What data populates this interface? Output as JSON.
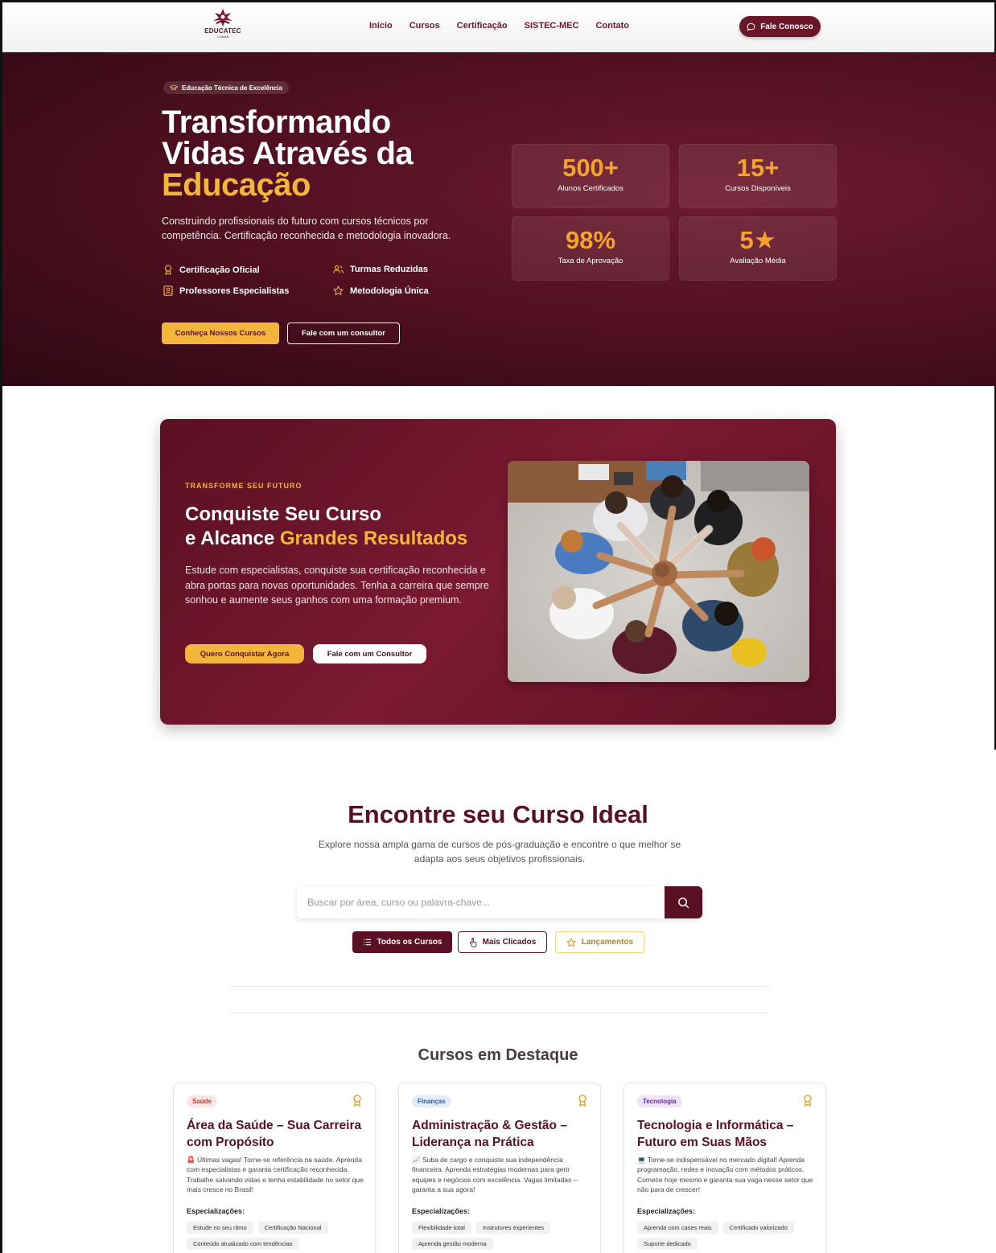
{
  "colors": {
    "brand": "#6b1528",
    "brand_dark": "#5a1024",
    "accent": "#f4b63a",
    "stat": "#f4a32f"
  },
  "header": {
    "logo_text": "EDUCATEC",
    "logo_sub": "CANAÃ",
    "nav": [
      "Início",
      "Cursos",
      "Certificação",
      "SISTEC-MEC",
      "Contato"
    ],
    "cta": "Fale Conosco",
    "cta_icon": "chat-bubble-icon"
  },
  "hero": {
    "badge": "Educação Técnica de Excelência",
    "title_line1": "Transformando",
    "title_line2": "Vidas Através da",
    "title_accent": "Educação",
    "description": "Construindo profissionais do futuro com cursos técnicos por competência. Certificação reconhecida e metodologia inovadora.",
    "features": [
      {
        "label": "Certificação Oficial",
        "icon": "award-icon"
      },
      {
        "label": "Turmas Reduzidas",
        "icon": "users-icon"
      },
      {
        "label": "Professores Especialistas",
        "icon": "teacher-icon"
      },
      {
        "label": "Metodologia Única",
        "icon": "star-icon"
      }
    ],
    "primary_button": "Conheça Nossos Cursos",
    "secondary_button": "Fale com um consultor",
    "stats": [
      {
        "value": "500+",
        "label": "Alunos Certificados"
      },
      {
        "value": "15+",
        "label": "Cursos Disponíveis"
      },
      {
        "value": "98%",
        "label": "Taxa de Aprovação"
      },
      {
        "value": "5★",
        "label": "Avaliação Média"
      }
    ]
  },
  "promo": {
    "eyebrow": "TRANSFORME SEU FUTURO",
    "title_line1": "Conquiste Seu Curso",
    "title_line2_plain": "e Alcance ",
    "title_line2_accent": "Grandes Resultados",
    "description": "Estude com especialistas, conquiste sua certificação reconhecida e abra portas para novas oportunidades. Tenha a carreira que sempre sonhou e aumente seus ganhos com uma formação premium.",
    "primary_button": "Quero Conquistar Agora",
    "secondary_button": "Fale com um Consultor"
  },
  "search": {
    "title": "Encontre seu Curso Ideal",
    "description": "Explore nossa ampla gama de cursos de pós-graduação e encontre o que melhor se adapta aos seus objetivos profissionais.",
    "placeholder": "Buscar por área, curso ou palavra-chave...",
    "filters": [
      "Todos os Cursos",
      "Mais Clicados",
      "Lançamentos"
    ],
    "selected_filter": "Todos os Cursos"
  },
  "featured": {
    "title": "Cursos em Destaque",
    "spec_label": "Especializações:",
    "cards": [
      {
        "tag": "Saúde",
        "title": "Área da Saúde – Sua Carreira com Propósito",
        "emoji": "🚨",
        "description": "Últimas vagas! Torne-se referência na saúde. Aprenda com especialistas e garanta certificação reconhecida. Trabalhe salvando vidas e tenha estabilidade no setor que mais cresce no Brasil!",
        "chips": [
          "Estude no seu ritmo",
          "Certificação Nacional",
          "Conteúdo atualizado com tendências"
        ]
      },
      {
        "tag": "Finanças",
        "title": "Administração & Gestão – Liderança na Prática",
        "emoji": "📈",
        "description": "Suba de cargo e conquiste sua independência financeira. Aprenda estratégias modernas para gerir equipes e negócios com excelência. Vagas limitadas – garanta a sua agora!",
        "chips": [
          "Flexibilidade total",
          "Instrutores experientes",
          "Aprenda gestão moderna"
        ]
      },
      {
        "tag": "Tecnologia",
        "title": "Tecnologia e Informática – Futuro em Suas Mãos",
        "emoji": "💻",
        "description": "Torne-se indispensável no mercado digital! Aprenda programação, redes e inovação com métodos práticos. Comece hoje mesmo e garanta sua vaga nesse setor que não para de crescer!",
        "chips": [
          "Aprenda com cases reais",
          "Certificado valorizado",
          "Suporte dedicado"
        ]
      }
    ]
  }
}
